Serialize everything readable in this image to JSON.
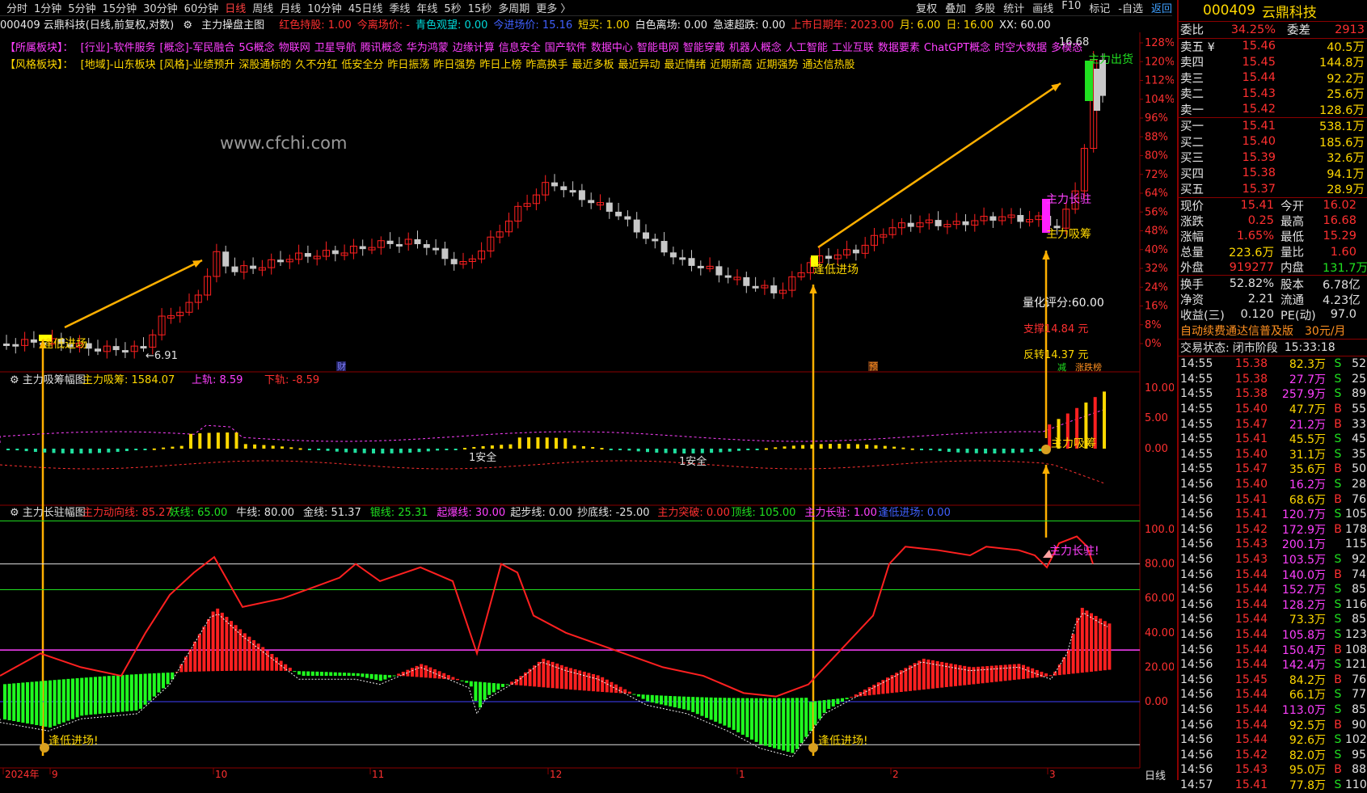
{
  "toolbar": {
    "left": [
      "分时",
      "1分钟",
      "5分钟",
      "15分钟",
      "30分钟",
      "60分钟",
      "日线",
      "周线",
      "月线",
      "10分钟",
      "45日线",
      "季线",
      "年线",
      "5秒",
      "15秒",
      "多周期",
      "更多 〉"
    ],
    "active_index": 6,
    "right": [
      "复权",
      "叠加",
      "多股",
      "统计",
      "画线",
      "F10",
      "标记",
      "-自选",
      "返回"
    ]
  },
  "info": {
    "title": "000409 云鼎科技(日线,前复权,对数)",
    "indicator": "主力操盘主图",
    "items": [
      {
        "t": "红色持股: 1.00",
        "c": "red"
      },
      {
        "t": "今离场价: -",
        "c": "red"
      },
      {
        "t": "青色观望: 0.00",
        "c": "cyan"
      },
      {
        "t": "今进场价: 15.16",
        "c": "blue"
      },
      {
        "t": "短买: 1.00",
        "c": "yellow"
      },
      {
        "t": "白色离场: 0.00",
        "c": "white"
      },
      {
        "t": "急速超跌: 0.00",
        "c": "white"
      },
      {
        "t": "上市日期年: 2023.00",
        "c": "red"
      },
      {
        "t": "月: 6.00",
        "c": "yellow"
      },
      {
        "t": "日: 16.00",
        "c": "yellow"
      },
      {
        "t": "XX: 60.00",
        "c": "white"
      }
    ]
  },
  "sectors": {
    "row1_label": "【所属板块】：",
    "row1": [
      "[行业]-软件服务",
      "[概念]-军民融合",
      "5G概念",
      "物联网",
      "卫星导航",
      "腾讯概念",
      "华为鸿蒙",
      "边缘计算",
      "信息安全",
      "国产软件",
      "数据中心",
      "智能电网",
      "智能穿戴",
      "机器人概念",
      "人工智能",
      "工业互联",
      "数据要素",
      "ChatGPT概念",
      "时空大数据",
      "多模态"
    ],
    "row2_label": "【风格板块】：",
    "row2": [
      "[地域]-山东板块",
      "[风格]-业绩预升",
      "深股通标的",
      "久不分红",
      "低安全分",
      "昨日振荡",
      "昨日强势",
      "昨日上榜",
      "昨高换手",
      "最近多板",
      "最近异动",
      "最近情绪",
      "近期新高",
      "近期强势",
      "通达信热股"
    ]
  },
  "watermark": "www.cfchi.com",
  "main_chart": {
    "pct_ticks": [
      "128%",
      "120%",
      "112%",
      "104%",
      "96%",
      "88%",
      "80%",
      "72%",
      "64%",
      "56%",
      "48%",
      "40%",
      "32%",
      "24%",
      "16%",
      "8%",
      "0%"
    ],
    "annotations": {
      "low_entry": "逢低进场",
      "high_mark": "16.68",
      "low_mark": "6.91",
      "main_exit": "主力出货",
      "main_stay": "主力长驻",
      "main_absorb": "主力吸筹",
      "score": "量化评分:60.00",
      "support": "支撑14.84 元",
      "reversal": "反转14.37 元",
      "cai": "财",
      "yu": "预",
      "jian": "减",
      "zhangting": "涨跌榜"
    }
  },
  "sub1": {
    "name": "主力吸筹幅图",
    "items": [
      {
        "t": "主力吸筹: 1584.07",
        "c": "yellow"
      },
      {
        "t": "上轨: 8.59",
        "c": "magenta"
      },
      {
        "t": "下轨: -8.59",
        "c": "red"
      }
    ],
    "ticks": [
      "10.00",
      "5.00",
      "0.00"
    ],
    "labels": {
      "safe": "1安全",
      "absorb": "主力吸筹"
    }
  },
  "sub2": {
    "name": "主力长驻幅图",
    "items": [
      {
        "t": "主力动向线: 85.27",
        "c": "red"
      },
      {
        "t": "妖线: 65.00",
        "c": "green"
      },
      {
        "t": "牛线: 80.00",
        "c": "white"
      },
      {
        "t": "金线: 51.37",
        "c": "white"
      },
      {
        "t": "银线: 25.31",
        "c": "green"
      },
      {
        "t": "起爆线: 30.00",
        "c": "magenta"
      },
      {
        "t": "起步线: 0.00",
        "c": "white"
      },
      {
        "t": "抄底线: -25.00",
        "c": "white"
      },
      {
        "t": "主力突破: 0.00",
        "c": "red"
      },
      {
        "t": "顶线: 105.00",
        "c": "green"
      },
      {
        "t": "主力长驻: 1.00",
        "c": "magenta"
      },
      {
        "t": "逢低进场: 0.00",
        "c": "blue"
      }
    ],
    "ticks": [
      "100.00",
      "80.00",
      "60.00",
      "40.00",
      "20.00",
      "0.00"
    ],
    "labels": {
      "low_entry": "逢低进场!",
      "main_stay": "主力长驻!"
    }
  },
  "xaxis": {
    "labels": [
      "2024年",
      "9",
      "10",
      "11",
      "12",
      "1",
      "2",
      "3"
    ],
    "period": "日线"
  },
  "panel": {
    "code": "000409",
    "name": "云鼎科技",
    "webi": {
      "label": "委比",
      "value": "34.25%",
      "label2": "委差",
      "value2": "2913"
    },
    "asks": [
      {
        "l": "卖五 ¥",
        "p": "15.46",
        "v": "40.5万"
      },
      {
        "l": "卖四",
        "p": "15.45",
        "v": "144.8万"
      },
      {
        "l": "卖三",
        "p": "15.44",
        "v": "92.2万"
      },
      {
        "l": "卖二",
        "p": "15.43",
        "v": "25.6万"
      },
      {
        "l": "卖一",
        "p": "15.42",
        "v": "128.6万"
      }
    ],
    "bids": [
      {
        "l": "买一",
        "p": "15.41",
        "v": "538.1万"
      },
      {
        "l": "买二",
        "p": "15.40",
        "v": "185.6万"
      },
      {
        "l": "买三",
        "p": "15.39",
        "v": "32.6万"
      },
      {
        "l": "买四",
        "p": "15.38",
        "v": "94.1万"
      },
      {
        "l": "买五",
        "p": "15.37",
        "v": "28.9万"
      }
    ],
    "quote": [
      {
        "a": "现价",
        "b": "15.41",
        "bc": "red",
        "c": "今开",
        "d": "16.02",
        "dc": "red"
      },
      {
        "a": "涨跌",
        "b": "0.25",
        "bc": "red",
        "c": "最高",
        "d": "16.68",
        "dc": "red"
      },
      {
        "a": "涨幅",
        "b": "1.65%",
        "bc": "red",
        "c": "最低",
        "d": "15.29",
        "dc": "red"
      },
      {
        "a": "总量",
        "b": "223.6万",
        "bc": "yellow",
        "c": "量比",
        "d": "1.60",
        "dc": "red"
      },
      {
        "a": "外盘",
        "b": "919277",
        "bc": "red",
        "c": "内盘",
        "d": "131.7万",
        "dc": "green"
      },
      {
        "a": "换手",
        "b": "52.82%",
        "bc": "white",
        "c": "股本",
        "d": "6.78亿",
        "dc": "white"
      },
      {
        "a": "净资",
        "b": "2.21",
        "bc": "white",
        "c": "流通",
        "d": "4.23亿",
        "dc": "white"
      },
      {
        "a": "收益(三)",
        "b": "0.120",
        "bc": "white",
        "c": "PE(动)",
        "d": "97.0",
        "dc": "white"
      }
    ],
    "ad": {
      "text": "自动续费通达信普及版",
      "price": "30元/月"
    },
    "status": {
      "label": "交易状态:",
      "value": "闭市阶段",
      "time": "15:33:18"
    },
    "ticks": [
      {
        "t": "14:55",
        "p": "15.38",
        "v": "82.3万",
        "s": "S",
        "n": "52"
      },
      {
        "t": "14:55",
        "p": "15.38",
        "v": "27.7万",
        "s": "S",
        "n": "25"
      },
      {
        "t": "14:55",
        "p": "15.38",
        "v": "257.9万",
        "s": "S",
        "n": "89"
      },
      {
        "t": "14:55",
        "p": "15.40",
        "v": "47.7万",
        "s": "B",
        "n": "55"
      },
      {
        "t": "14:55",
        "p": "15.47",
        "v": "21.2万",
        "s": "B",
        "n": "33"
      },
      {
        "t": "14:55",
        "p": "15.41",
        "v": "45.5万",
        "s": "S",
        "n": "45"
      },
      {
        "t": "14:55",
        "p": "15.40",
        "v": "31.1万",
        "s": "S",
        "n": "35"
      },
      {
        "t": "14:55",
        "p": "15.47",
        "v": "35.6万",
        "s": "B",
        "n": "50"
      },
      {
        "t": "14:56",
        "p": "15.40",
        "v": "16.2万",
        "s": "S",
        "n": "28"
      },
      {
        "t": "14:56",
        "p": "15.41",
        "v": "68.6万",
        "s": "B",
        "n": "76"
      },
      {
        "t": "14:56",
        "p": "15.41",
        "v": "120.7万",
        "s": "S",
        "n": "105"
      },
      {
        "t": "14:56",
        "p": "15.42",
        "v": "172.9万",
        "s": "B",
        "n": "178"
      },
      {
        "t": "14:56",
        "p": "15.43",
        "v": "200.1万",
        "s": "",
        "n": "115"
      },
      {
        "t": "14:56",
        "p": "15.43",
        "v": "103.5万",
        "s": "S",
        "n": "92"
      },
      {
        "t": "14:56",
        "p": "15.44",
        "v": "140.0万",
        "s": "B",
        "n": "74"
      },
      {
        "t": "14:56",
        "p": "15.44",
        "v": "152.7万",
        "s": "S",
        "n": "85"
      },
      {
        "t": "14:56",
        "p": "15.44",
        "v": "128.2万",
        "s": "S",
        "n": "116"
      },
      {
        "t": "14:56",
        "p": "15.44",
        "v": "73.3万",
        "s": "S",
        "n": "85"
      },
      {
        "t": "14:56",
        "p": "15.44",
        "v": "105.8万",
        "s": "S",
        "n": "123"
      },
      {
        "t": "14:56",
        "p": "15.44",
        "v": "150.4万",
        "s": "B",
        "n": "108"
      },
      {
        "t": "14:56",
        "p": "15.44",
        "v": "142.4万",
        "s": "S",
        "n": "121"
      },
      {
        "t": "14:56",
        "p": "15.45",
        "v": "84.2万",
        "s": "B",
        "n": "76"
      },
      {
        "t": "14:56",
        "p": "15.44",
        "v": "66.1万",
        "s": "S",
        "n": "77"
      },
      {
        "t": "14:56",
        "p": "15.44",
        "v": "113.0万",
        "s": "S",
        "n": "85"
      },
      {
        "t": "14:56",
        "p": "15.44",
        "v": "92.5万",
        "s": "B",
        "n": "90"
      },
      {
        "t": "14:56",
        "p": "15.44",
        "v": "92.6万",
        "s": "S",
        "n": "102"
      },
      {
        "t": "14:56",
        "p": "15.42",
        "v": "82.0万",
        "s": "S",
        "n": "95"
      },
      {
        "t": "14:56",
        "p": "15.43",
        "v": "95.0万",
        "s": "B",
        "n": "88"
      },
      {
        "t": "14:57",
        "p": "15.41",
        "v": "77.8万",
        "s": "S",
        "n": "110"
      }
    ]
  },
  "colors": {
    "up": "#ff2020",
    "down": "#c8c8c8",
    "greenbar": "#20ff20",
    "arrow": "#ffb000",
    "axis": "#8a0000"
  }
}
